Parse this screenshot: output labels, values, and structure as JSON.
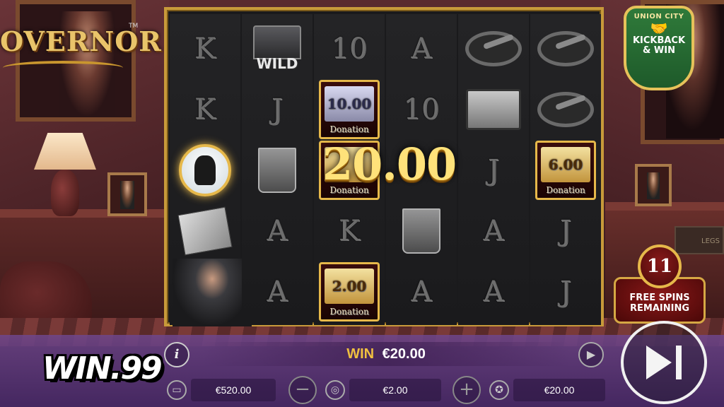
{
  "game": {
    "logo_text": "OVERNOR",
    "logo_tm": "TM",
    "badge": {
      "top": "UNION CITY",
      "line1": "KICKBACK",
      "line2": "& WIN"
    },
    "free_spins": {
      "count": "11",
      "line1": "FREE SPINS",
      "line2": "REMAINING"
    },
    "book_label": "LEGS"
  },
  "reels": [
    {
      "cells": [
        "K",
        "K",
        "gangster",
        "document",
        "boss"
      ]
    },
    {
      "cells": [
        "WILD",
        "J",
        "glass",
        "A",
        "A"
      ]
    },
    {
      "cells": [
        "10",
        "donation",
        "donation",
        "K",
        "donation"
      ]
    },
    {
      "cells": [
        "A",
        "10",
        "",
        "glass",
        "A"
      ]
    },
    {
      "cells": [
        "ashtray",
        "briefcase",
        "J",
        "A",
        "A"
      ]
    },
    {
      "cells": [
        "ashtray",
        "ashtray",
        "donation",
        "J",
        "J"
      ]
    }
  ],
  "symbols": {
    "wild_label": "WILD",
    "donations": [
      {
        "value": "10.00",
        "label": "Donation",
        "style": "silver"
      },
      {
        "value": "",
        "label": "Donation",
        "style": "gold"
      },
      {
        "value": "2.00",
        "label": "Donation",
        "style": "gold"
      },
      {
        "value": "6.00",
        "label": "Donation",
        "style": "gold"
      }
    ]
  },
  "big_win": "20.00",
  "bottom_bar": {
    "info_label": "i",
    "win_label": "WIN",
    "win_amount": "€20.00",
    "balance": "€520.00",
    "bet": "€2.00",
    "last_win": "€20.00",
    "minus_label": "−",
    "plus_label": "+",
    "fast_label": "▶"
  },
  "brand": "WIN.99",
  "colors": {
    "gold": "#e6b84a",
    "win_text": "#f0c040",
    "badge_green": "#2f7a3a"
  }
}
